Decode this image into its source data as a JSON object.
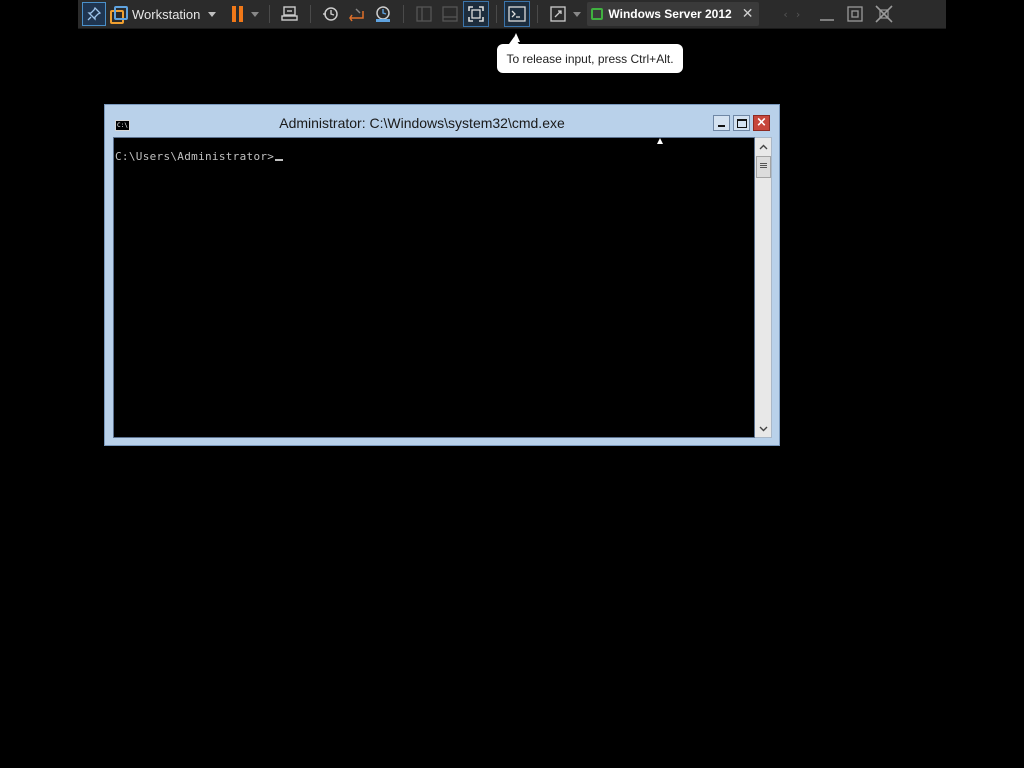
{
  "toolbar": {
    "vm_menu_label": "Workstation",
    "tab_label": "Windows Server 2012",
    "tab_close": "✕",
    "icons": [
      "pin-icon",
      "vm-library-icon",
      "pause-icon",
      "send-ctrl-alt-del-icon",
      "snapshot-icon",
      "revert-snapshot-icon",
      "snapshot-manager-icon",
      "console-view-icon",
      "thumbnail-bar-icon",
      "full-screen-icon",
      "unity-icon",
      "stretch-icon"
    ]
  },
  "tooltip": {
    "text": "To release input, press Ctrl+Alt."
  },
  "cmd_window": {
    "icon_text": "C:\\",
    "title": "Administrator: C:\\Windows\\system32\\cmd.exe",
    "close_glyph": "×",
    "prompt": "C:\\Users\\Administrator>"
  },
  "colors": {
    "desktop_bg": "#000000",
    "toolbar_bg": "#2b2b2b",
    "window_frame": "#b9d1ea",
    "close_button": "#c7463b",
    "pause_orange": "#f07818"
  }
}
